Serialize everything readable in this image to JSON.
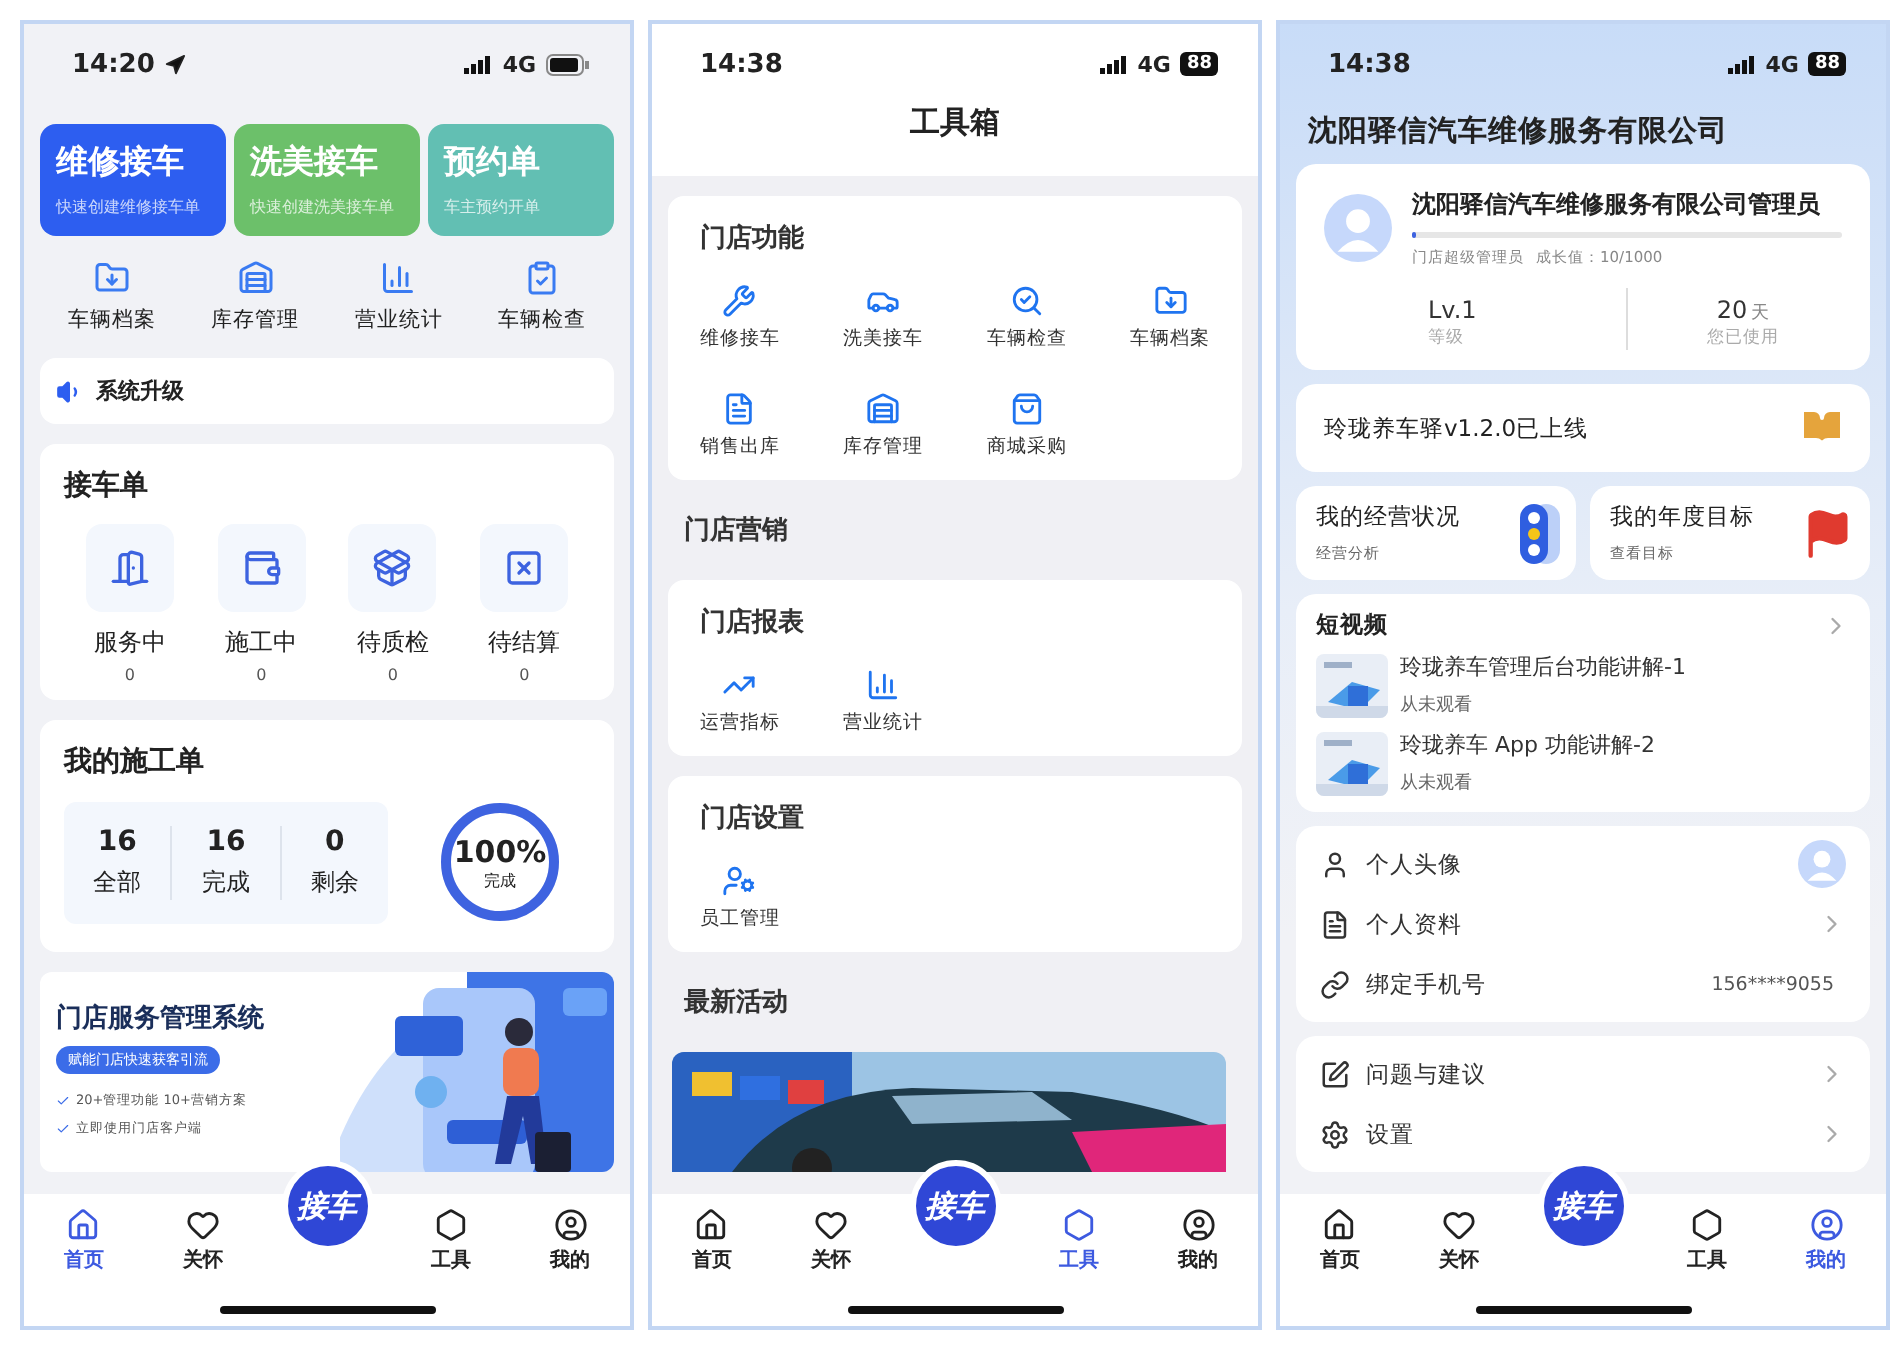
{
  "home_screen": {
    "status": {
      "time": "14:20",
      "network": "4G"
    },
    "quick_cards": [
      {
        "title": "维修接车",
        "subtitle": "快速创建维修接车单",
        "color": "#2d5ef0"
      },
      {
        "title": "洗美接车",
        "subtitle": "快速创建洗美接车单",
        "color": "#6cc06a"
      },
      {
        "title": "预约单",
        "subtitle": "车主预约开单",
        "color": "#62bfb3"
      }
    ],
    "shortcuts": [
      "车辆档案",
      "库存管理",
      "营业统计",
      "车辆检查"
    ],
    "notice": "系统升级",
    "orders": {
      "title": "接车单",
      "items": [
        {
          "label": "服务中",
          "count": "0"
        },
        {
          "label": "施工中",
          "count": "0"
        },
        {
          "label": "待质检",
          "count": "0"
        },
        {
          "label": "待结算",
          "count": "0"
        }
      ]
    },
    "work": {
      "title": "我的施工单",
      "stats": [
        {
          "value": "16",
          "label": "全部"
        },
        {
          "value": "16",
          "label": "完成"
        },
        {
          "value": "0",
          "label": "剩余"
        }
      ],
      "progress": {
        "percent": "100%",
        "label": "完成",
        "level": 1
      }
    },
    "banner": {
      "title": "门店服务管理系统",
      "tag": "赋能门店快速获客引流",
      "bullets": [
        "20+管理功能 10+营销方案",
        "立即使用门店客户端"
      ]
    },
    "tab_bar": {
      "center": "接车",
      "tabs": [
        {
          "label": "首页",
          "selected": true
        },
        {
          "label": "关怀",
          "selected": false
        },
        {
          "label": "工具",
          "selected": false
        },
        {
          "label": "我的",
          "selected": false
        }
      ]
    }
  },
  "toolbox_screen": {
    "status": {
      "time": "14:38",
      "network": "4G",
      "battery": "88"
    },
    "title": "工具箱",
    "sections": [
      {
        "kind": "card",
        "title": "门店功能",
        "items": [
          "维修接车",
          "洗美接车",
          "车辆检查",
          "车辆档案",
          "销售出库",
          "库存管理",
          "商城采购"
        ]
      },
      {
        "kind": "heading",
        "title": "门店营销"
      },
      {
        "kind": "card",
        "title": "门店报表",
        "items": [
          "运营指标",
          "营业统计"
        ]
      },
      {
        "kind": "card",
        "title": "门店设置",
        "items": [
          "员工管理"
        ]
      },
      {
        "kind": "heading",
        "title": "最新活动"
      }
    ],
    "tab_bar": {
      "center": "接车",
      "tabs": [
        {
          "label": "首页",
          "selected": false
        },
        {
          "label": "关怀",
          "selected": false
        },
        {
          "label": "工具",
          "selected": true
        },
        {
          "label": "我的",
          "selected": false
        }
      ]
    }
  },
  "profile_screen": {
    "status": {
      "time": "14:38",
      "network": "4G",
      "battery": "88"
    },
    "company": "沈阳驿信汽车维修服务有限公司",
    "profile": {
      "name": "沈阳驿信汽车维修服务有限公司管理员",
      "role": "门店超级管理员",
      "growth": "成长值：10/1000",
      "level": 0.01,
      "stats": [
        {
          "value": "Lv.1",
          "label": "等级"
        },
        {
          "value": "20",
          "unit": "天",
          "label": "您已使用"
        }
      ]
    },
    "announcement": "玲珑养车驿v1.2.0已上线",
    "tiles": [
      {
        "title": "我的经营状况",
        "subtitle": "经营分析"
      },
      {
        "title": "我的年度目标",
        "subtitle": "查看目标"
      }
    ],
    "videos": {
      "title": "短视频",
      "items": [
        {
          "title": "玲珑养车管理后台功能讲解-1",
          "status": "从未观看"
        },
        {
          "title": "玲珑养车 App 功能讲解-2",
          "status": "从未观看"
        }
      ]
    },
    "settings": [
      [
        {
          "kind": "avatar",
          "label": "个人头像"
        },
        {
          "kind": "arrow",
          "label": "个人资料"
        },
        {
          "kind": "value",
          "label": "绑定手机号",
          "value": "156****9055"
        }
      ],
      [
        {
          "kind": "arrow",
          "label": "问题与建议"
        },
        {
          "kind": "arrow",
          "label": "设置"
        }
      ]
    ],
    "tab_bar": {
      "center": "接车",
      "tabs": [
        {
          "label": "首页",
          "selected": false
        },
        {
          "label": "关怀",
          "selected": false
        },
        {
          "label": "工具",
          "selected": false
        },
        {
          "label": "我的",
          "selected": true
        }
      ]
    }
  }
}
